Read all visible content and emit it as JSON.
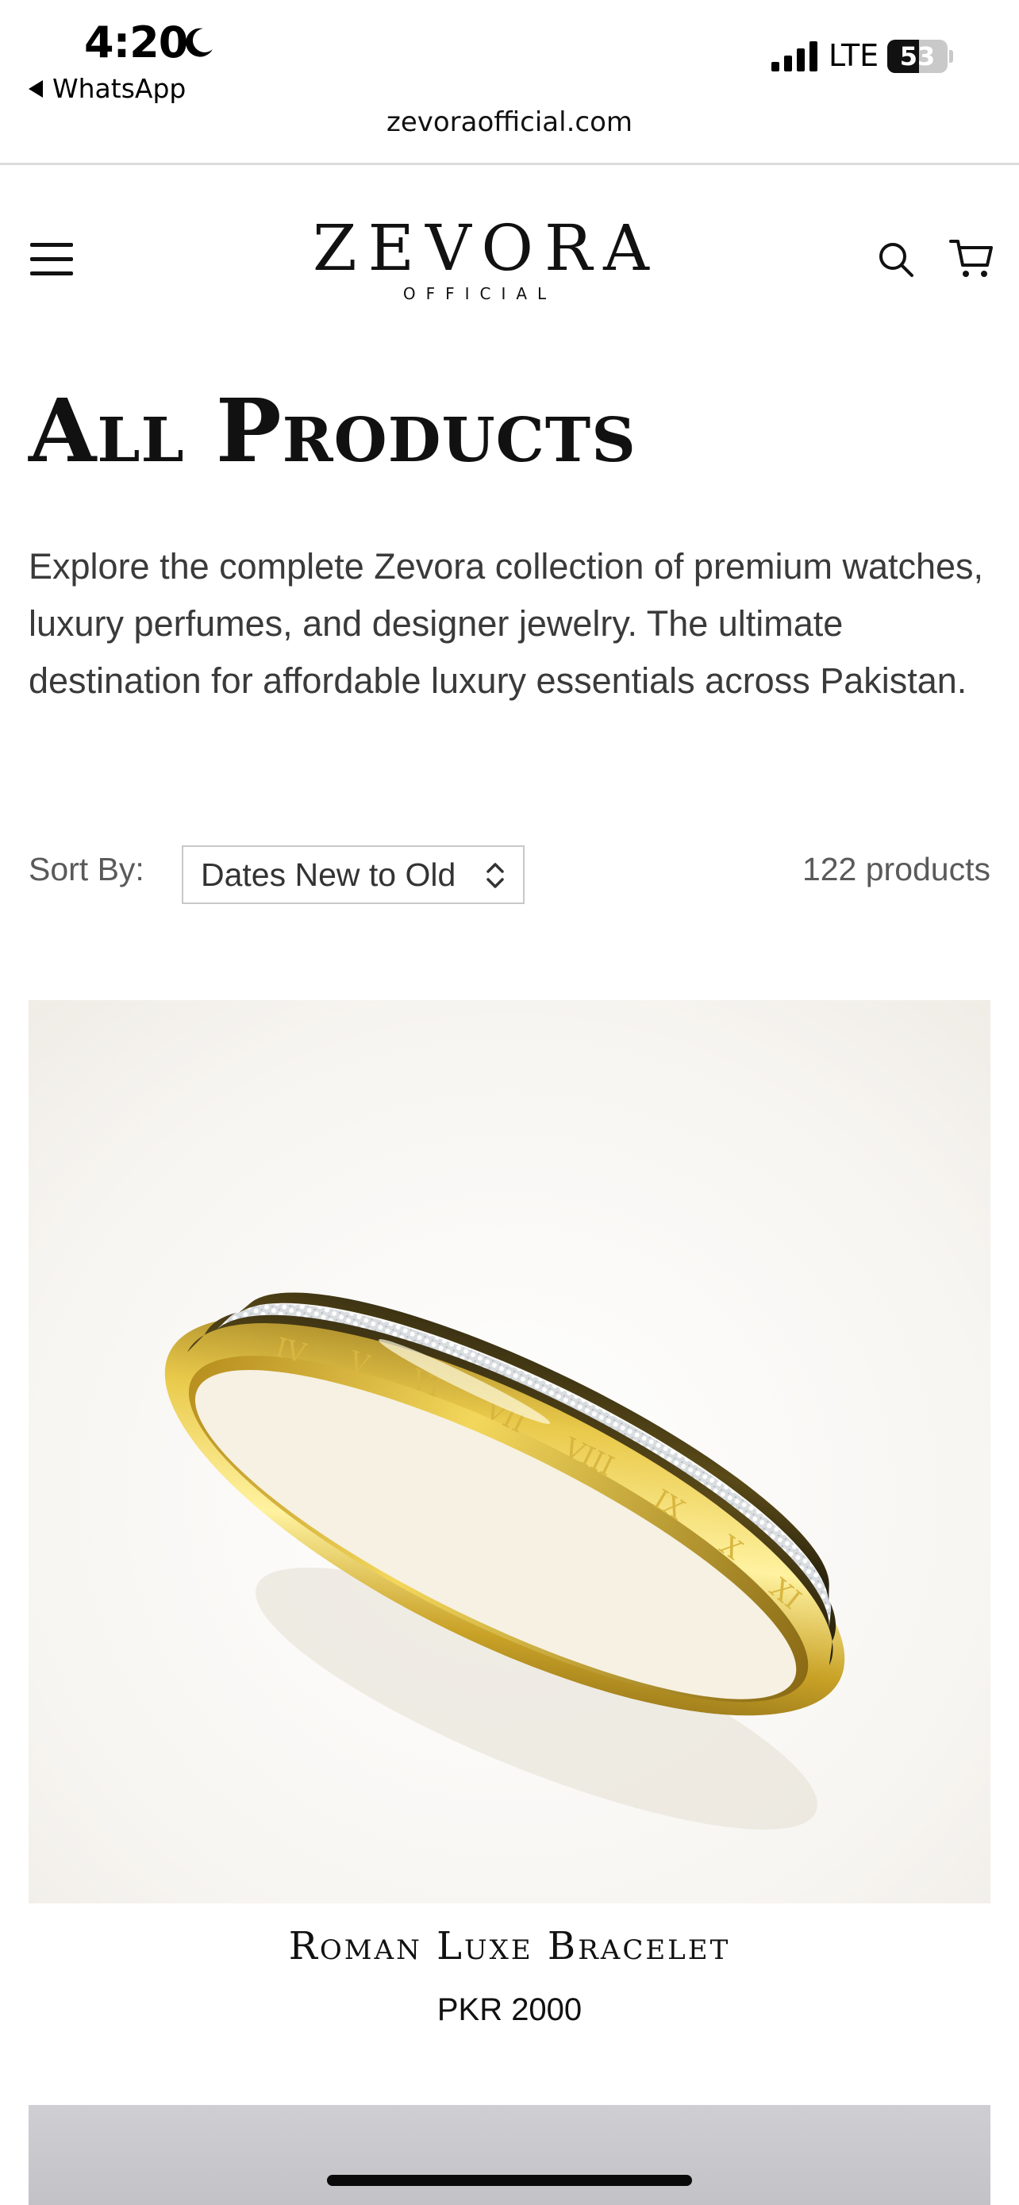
{
  "status_bar": {
    "time": "4:20",
    "back_app_label": "WhatsApp",
    "network": "LTE",
    "battery_level": "53",
    "battery_fraction": 0.53
  },
  "browser": {
    "url": "zevoraofficial.com"
  },
  "header": {
    "logo_main": "ZEVORA",
    "logo_sub": "OFFICIAL",
    "icons": [
      "menu-icon",
      "search-icon",
      "cart-icon"
    ]
  },
  "collection": {
    "title": "All Products",
    "description": "Explore the complete Zevora collection of premium watches, luxury perfumes, and designer jewelry. The ultimate destination for affordable luxury essentials across Pakistan.",
    "sort_label": "Sort By:",
    "sort_selected": "Dates New to Old",
    "product_count": "122 products"
  },
  "products": [
    {
      "name": "Roman Luxe Bracelet",
      "price": "PKR 2000"
    }
  ],
  "colors": {
    "text": "#111111",
    "muted_text": "#5a5a5a",
    "gold": "#c9a227",
    "divider": "#dcdcdc"
  }
}
